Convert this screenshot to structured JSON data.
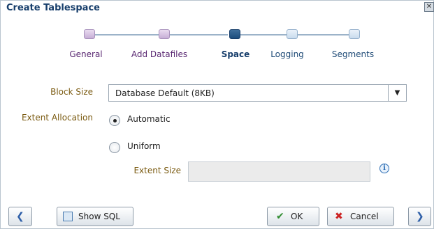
{
  "dialog": {
    "title": "Create Tablespace",
    "close_glyph": "✕"
  },
  "steps": [
    {
      "label": "General",
      "state": "visited"
    },
    {
      "label": "Add Datafiles",
      "state": "visited"
    },
    {
      "label": "Space",
      "state": "current"
    },
    {
      "label": "Logging",
      "state": "future"
    },
    {
      "label": "Segments",
      "state": "future"
    }
  ],
  "form": {
    "block_size_label": "Block Size",
    "block_size_value": "Database Default (8KB)",
    "extent_allocation_label": "Extent Allocation",
    "radio_automatic": "Automatic",
    "radio_uniform": "Uniform",
    "selected_allocation": "Automatic",
    "extent_size_label": "Extent Size",
    "extent_size_value": ""
  },
  "footer": {
    "show_sql_label": "Show SQL",
    "ok_label": "OK",
    "cancel_label": "Cancel"
  },
  "icons": {
    "back": "back-arrow-icon",
    "next": "next-arrow-icon",
    "show_sql": "sql-document-icon",
    "ok": "checkmark-icon",
    "cancel": "cancel-x-icon",
    "info": "info-icon",
    "dropdown": "dropdown-arrow-icon"
  },
  "colors": {
    "title": "#173e6b",
    "label": "#7a5a10",
    "visited": "#5b2a73",
    "current": "#173e6b",
    "ok_check": "#2e8b2e",
    "cancel_x": "#cc2222",
    "nav_arrow": "#2e5fa8"
  }
}
